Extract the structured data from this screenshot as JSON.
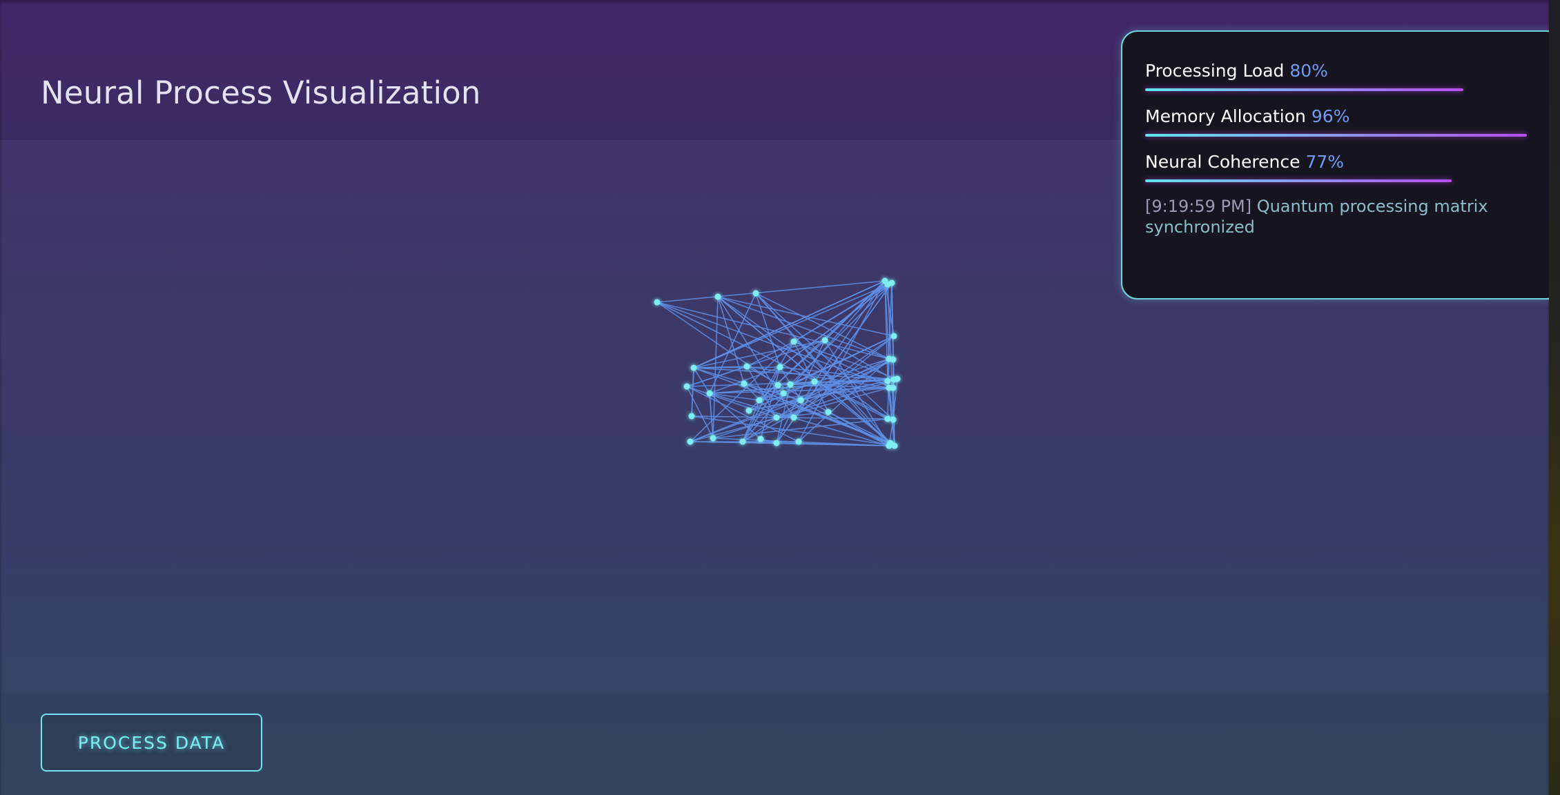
{
  "page": {
    "title": "Neural Process Visualization"
  },
  "metrics": [
    {
      "label": "Processing Load",
      "value": "80%",
      "level": 0.8
    },
    {
      "label": "Memory Allocation",
      "value": "96%",
      "level": 0.96
    },
    {
      "label": "Neural Coherence",
      "value": "77%",
      "level": 0.77
    }
  ],
  "log": {
    "time": "[9:19:59 PM]",
    "message": "Quantum processing matrix synchronized"
  },
  "actions": {
    "process_label": "PROCESS DATA"
  },
  "colors": {
    "accent_cyan": "#6fe6ee",
    "accent_purple": "#b84df0",
    "value_blue": "#6f9bf0",
    "network_line": "#5f8fe6",
    "network_node": "#7feef2"
  },
  "icons": []
}
